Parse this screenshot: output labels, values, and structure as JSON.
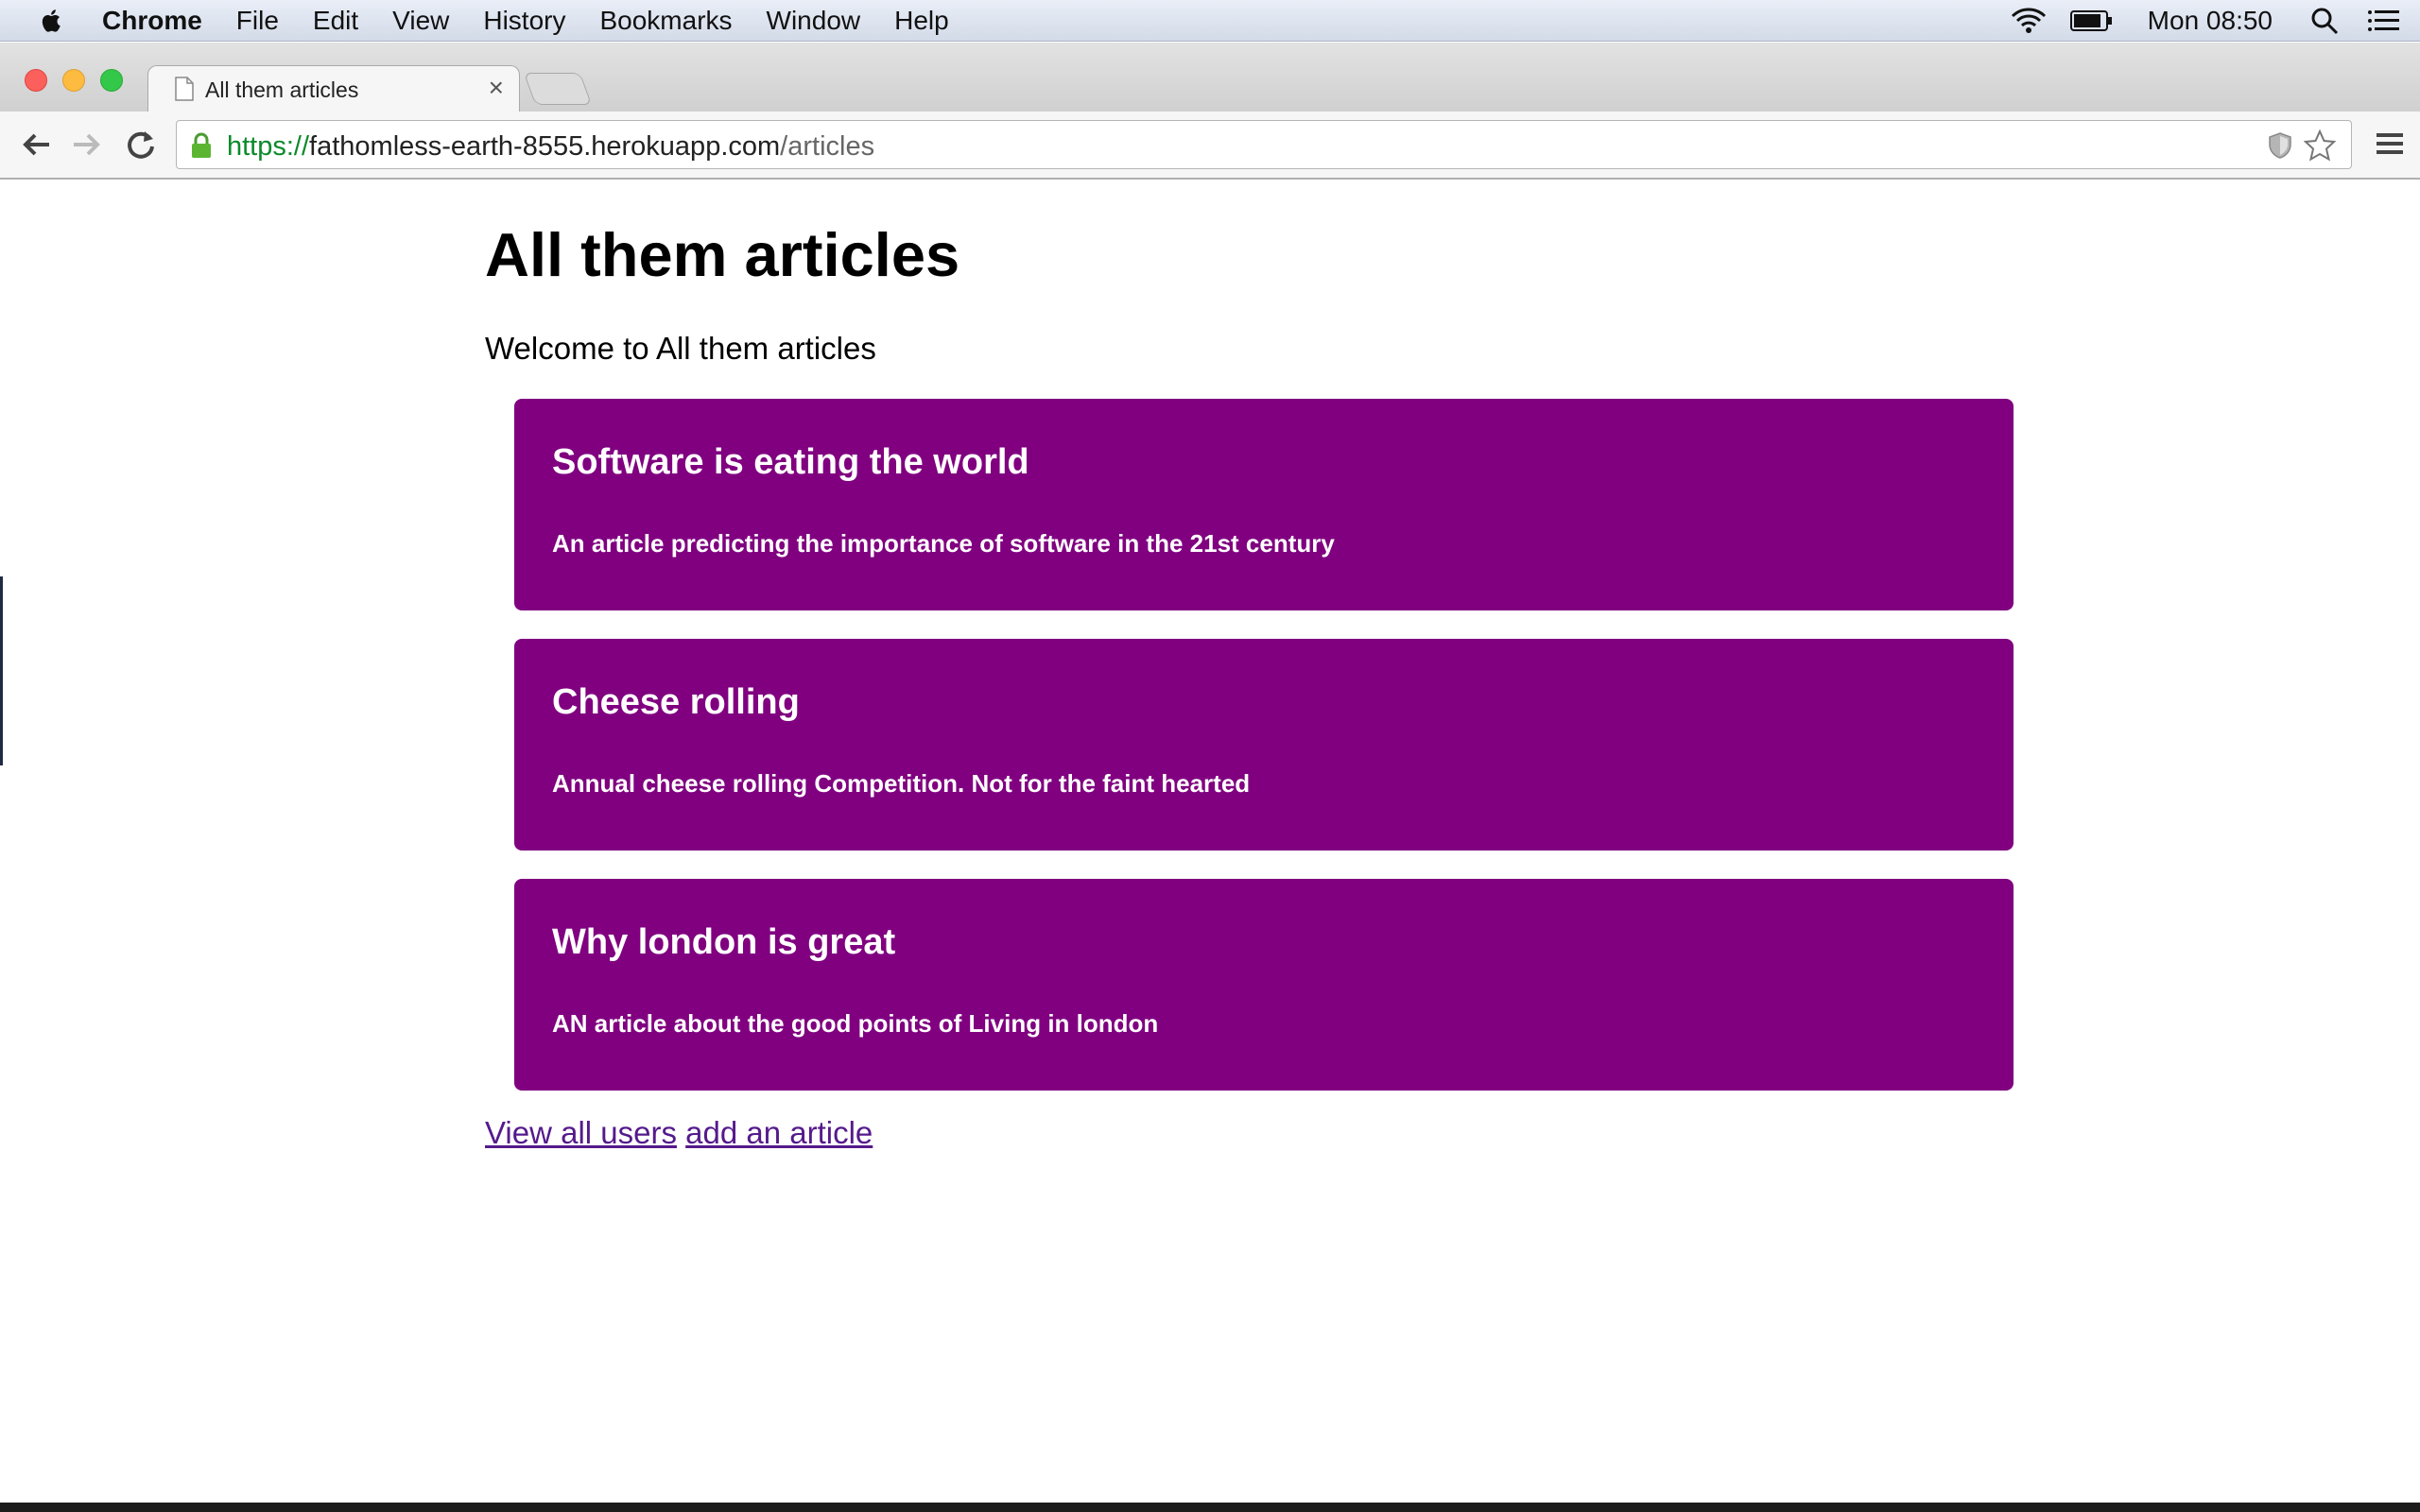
{
  "menubar": {
    "app_name": "Chrome",
    "menus": [
      "File",
      "Edit",
      "View",
      "History",
      "Bookmarks",
      "Window",
      "Help"
    ],
    "clock": "Mon 08:50"
  },
  "browser": {
    "tab_title": "All them articles",
    "tab_close": "×",
    "url_scheme": "https://",
    "url_host": "fathomless-earth-8555.herokuapp.com",
    "url_path": "/articles"
  },
  "page": {
    "heading": "All them articles",
    "welcome": "Welcome to All them articles",
    "articles": [
      {
        "title": "Software is eating the world",
        "description": "An article predicting the importance of software in the 21st century"
      },
      {
        "title": "Cheese rolling",
        "description": "Annual cheese rolling Competition. Not for the faint hearted"
      },
      {
        "title": "Why london is great",
        "description": "AN article about the good points of Living in london"
      }
    ],
    "links": {
      "view_users": "View all users",
      "add_article": "add an article"
    }
  },
  "colors": {
    "card_background": "#800080",
    "card_text": "#ffffff",
    "link": "#551a8b",
    "secure_scheme": "#0b8a2b"
  }
}
